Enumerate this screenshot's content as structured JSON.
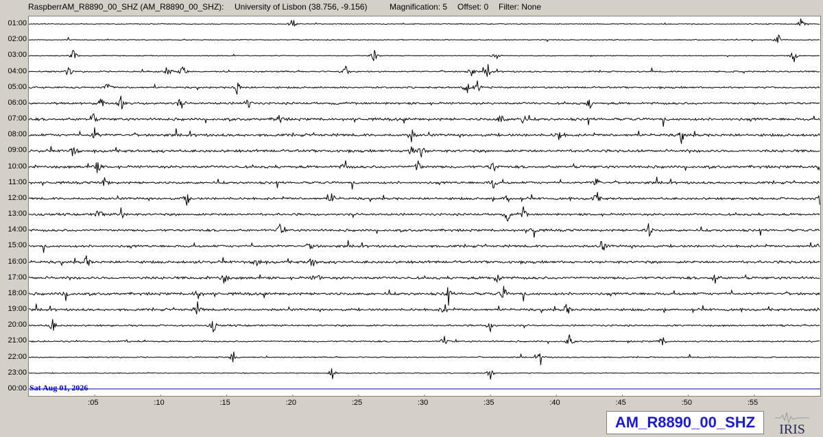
{
  "header": {
    "station": "RaspberrAM_R8890_00_SHZ (AM_R8890_00_SHZ):",
    "location": "University of Lisbon (38.756, -9.156)",
    "magnification": "Magnification: 5",
    "offset": "Offset: 0",
    "filter": "Filter: None"
  },
  "footer": {
    "date": "Sat Aug 01, 2026",
    "station_code": "AM_R8890_00_SHZ",
    "logo_text": "IRIS"
  },
  "colors": {
    "trace": "#000000",
    "current_line": "#0000cc",
    "background": "#d4d0c8",
    "plot_bg": "#ffffff",
    "station_text": "#1a1adc"
  },
  "chart_data": {
    "type": "line",
    "title": "RaspberrAM_R8890_00_SHZ (AM_R8890_00_SHZ)",
    "xlabel": "",
    "ylabel": "",
    "x_tick_labels": [
      ":05",
      ":10",
      ":15",
      ":20",
      ":25",
      ":30",
      ":35",
      ":40",
      ":45",
      ":50",
      ":55"
    ],
    "x_range": [
      0,
      60
    ],
    "row_labels": [
      "01:00",
      "02:00",
      "03:00",
      "04:00",
      "05:00",
      "06:00",
      "07:00",
      "08:00",
      "09:00",
      "10:00",
      "11:00",
      "12:00",
      "13:00",
      "14:00",
      "15:00",
      "16:00",
      "17:00",
      "18:00",
      "19:00",
      "20:00",
      "21:00",
      "22:00",
      "23:00",
      "00:00"
    ],
    "row_noise_level": [
      0.3,
      0.3,
      0.3,
      0.5,
      0.6,
      0.8,
      0.9,
      0.9,
      0.9,
      0.9,
      0.8,
      0.8,
      0.8,
      0.8,
      0.8,
      0.9,
      0.9,
      0.9,
      0.8,
      0.6,
      0.5,
      0.4,
      0.3,
      0
    ],
    "events": [
      {
        "row": 0,
        "minutes": [
          20.0,
          58.5
        ]
      },
      {
        "row": 1,
        "minutes": [
          56.8
        ]
      },
      {
        "row": 2,
        "minutes": [
          3.4,
          26.2,
          35.5,
          58.0
        ]
      },
      {
        "row": 3,
        "minutes": [
          3.0,
          10.5,
          11.7,
          24.0,
          33.5,
          34.8
        ]
      },
      {
        "row": 4,
        "minutes": [
          6.0,
          15.8,
          33.2,
          34.0
        ]
      },
      {
        "row": 5,
        "minutes": [
          5.5,
          7.0,
          11.5,
          16.6,
          42.5
        ]
      },
      {
        "row": 6,
        "minutes": [
          4.8,
          19.0,
          35.8,
          37.4
        ]
      },
      {
        "row": 7,
        "minutes": [
          5.0,
          29.0,
          40.2,
          49.5
        ]
      },
      {
        "row": 8,
        "minutes": [
          3.4,
          29.0,
          29.8
        ]
      },
      {
        "row": 9,
        "minutes": [
          5.2,
          24.0,
          29.5,
          35.2,
          60.0
        ]
      },
      {
        "row": 10,
        "minutes": [
          5.8,
          35.2,
          43.0
        ]
      },
      {
        "row": 11,
        "minutes": [
          12.0,
          23.0,
          36.3,
          43.0,
          60.0
        ]
      },
      {
        "row": 12,
        "minutes": [
          5.3,
          7.0,
          36.3,
          37.5
        ]
      },
      {
        "row": 13,
        "minutes": [
          19.0,
          38.3,
          47.0
        ]
      },
      {
        "row": 14,
        "minutes": [
          21.5,
          43.5,
          60.0
        ]
      },
      {
        "row": 15,
        "minutes": [
          4.4,
          17.3,
          21.5
        ]
      },
      {
        "row": 16,
        "minutes": [
          14.8,
          21.8,
          35.5,
          52.0
        ]
      },
      {
        "row": 17,
        "minutes": [
          2.8,
          12.8,
          31.8,
          36.0
        ]
      },
      {
        "row": 18,
        "minutes": [
          12.8,
          31.5,
          40.8,
          60.0
        ]
      },
      {
        "row": 19,
        "minutes": [
          1.8,
          14.0,
          35.0
        ]
      },
      {
        "row": 20,
        "minutes": [
          31.5,
          41.0,
          48.0
        ]
      },
      {
        "row": 21,
        "minutes": [
          15.5,
          38.8
        ]
      },
      {
        "row": 22,
        "minutes": [
          23.0,
          35.0
        ]
      }
    ]
  }
}
